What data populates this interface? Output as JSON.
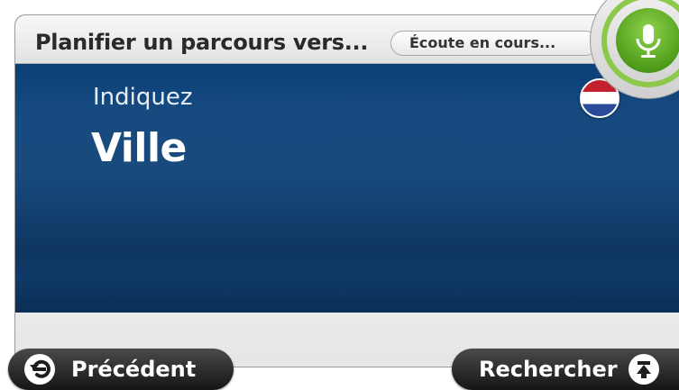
{
  "header": {
    "title": "Planifier un parcours vers...",
    "status": "Écoute en cours..."
  },
  "main": {
    "prompt": "Indiquez",
    "field": "Ville",
    "flag_icon": "netherlands-flag-icon"
  },
  "footer": {
    "back_label": "Précédent",
    "search_label": "Rechercher"
  },
  "icons": {
    "mic": "microphone-icon",
    "back": "back-arrow-icon",
    "search": "keyboard-up-icon"
  },
  "colors": {
    "panel": "#174b80",
    "mic_accent": "#5aab22",
    "button_dark": "#1e1e1e"
  }
}
